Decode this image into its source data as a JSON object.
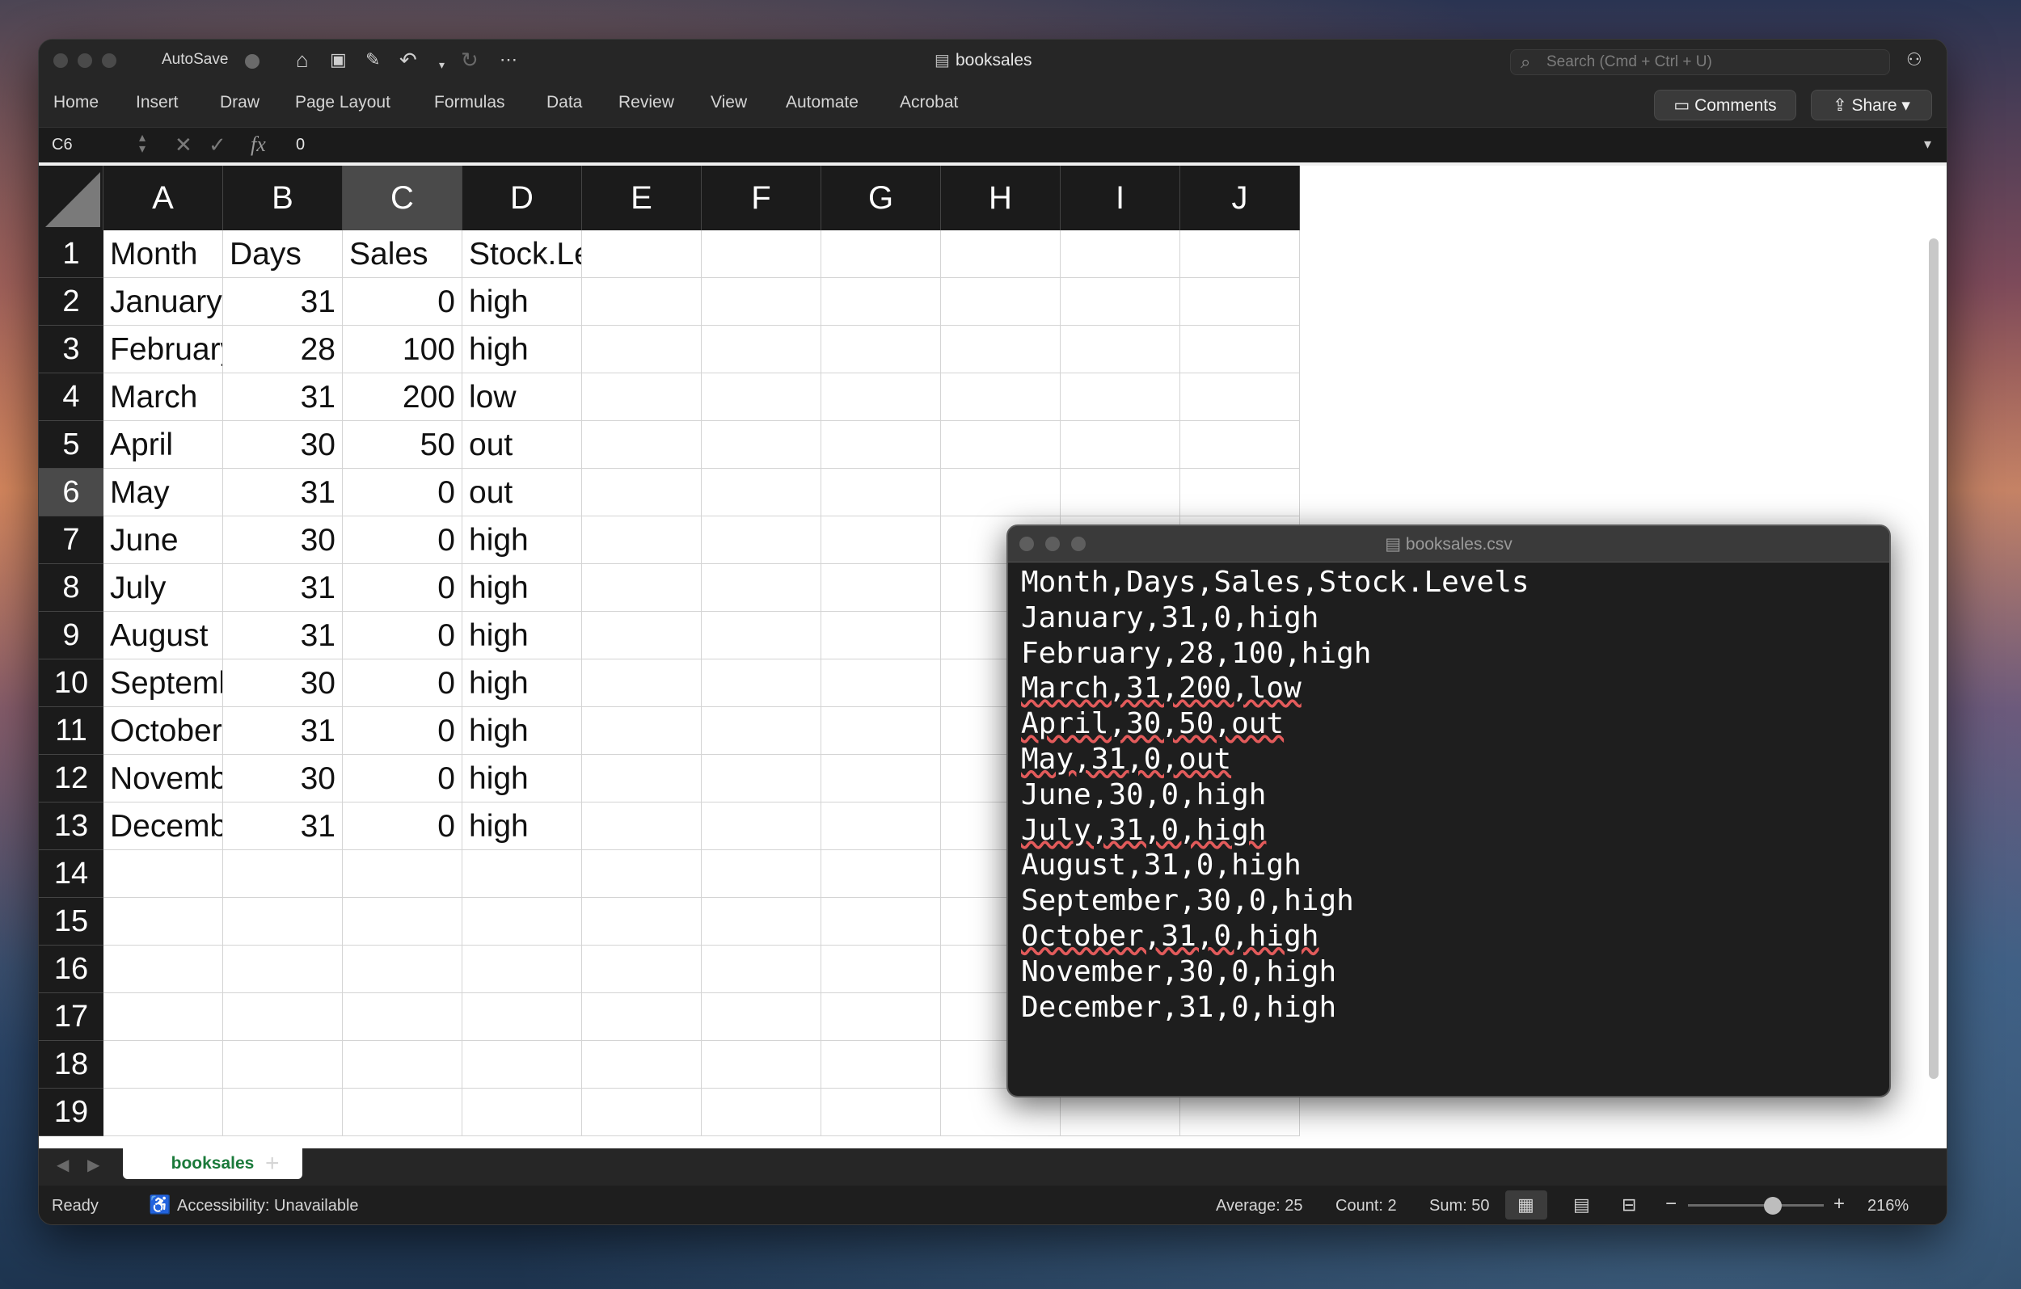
{
  "window": {
    "title": "booksales",
    "autosave_label": "AutoSave",
    "search_placeholder": "Search (Cmd + Ctrl + U)"
  },
  "ribbon": {
    "tabs": [
      "Home",
      "Insert",
      "Draw",
      "Page Layout",
      "Formulas",
      "Data",
      "Review",
      "View",
      "Automate",
      "Acrobat"
    ],
    "comments_label": "Comments",
    "share_label": "Share"
  },
  "formula_bar": {
    "name_box": "C6",
    "fx_label": "fx",
    "value": "0"
  },
  "columns": [
    "A",
    "B",
    "C",
    "D",
    "E",
    "F",
    "G",
    "H",
    "I",
    "J"
  ],
  "selected_column": "C",
  "rows": [
    "1",
    "2",
    "3",
    "4",
    "5",
    "6",
    "7",
    "8",
    "9",
    "10",
    "11",
    "12",
    "13",
    "14",
    "15",
    "16",
    "17",
    "18",
    "19"
  ],
  "selected_row": "6",
  "cells": [
    [
      "Month",
      "Days",
      "Sales",
      "Stock.Levels"
    ],
    [
      "January",
      "31",
      "0",
      "high"
    ],
    [
      "February",
      "28",
      "100",
      "high"
    ],
    [
      "March",
      "31",
      "200",
      "low"
    ],
    [
      "April",
      "30",
      "50",
      "out"
    ],
    [
      "May",
      "31",
      "0",
      "out"
    ],
    [
      "June",
      "30",
      "0",
      "high"
    ],
    [
      "July",
      "31",
      "0",
      "high"
    ],
    [
      "August",
      "31",
      "0",
      "high"
    ],
    [
      "September",
      "30",
      "0",
      "high"
    ],
    [
      "October",
      "31",
      "0",
      "high"
    ],
    [
      "November",
      "30",
      "0",
      "high"
    ],
    [
      "December",
      "31",
      "0",
      "high"
    ]
  ],
  "sheet": {
    "tab_label": "booksales",
    "add_label": "+"
  },
  "status": {
    "ready": "Ready",
    "accessibility": "Accessibility: Unavailable",
    "average": "Average: 25",
    "count": "Count: 2",
    "sum": "Sum: 50",
    "zoom": "216%"
  },
  "csv_window": {
    "title": "booksales.csv",
    "lines": [
      "Month,Days,Sales,Stock.Levels",
      "January,31,0,high",
      "February,28,100,high",
      "March,31,200,low",
      "April,30,50,out",
      "May,31,0,out",
      "June,30,0,high",
      "July,31,0,high",
      "August,31,0,high",
      "September,30,0,high",
      "October,31,0,high",
      "November,30,0,high",
      "December,31,0,high"
    ],
    "squiggle_lines": [
      3,
      4,
      5,
      7,
      10
    ]
  }
}
